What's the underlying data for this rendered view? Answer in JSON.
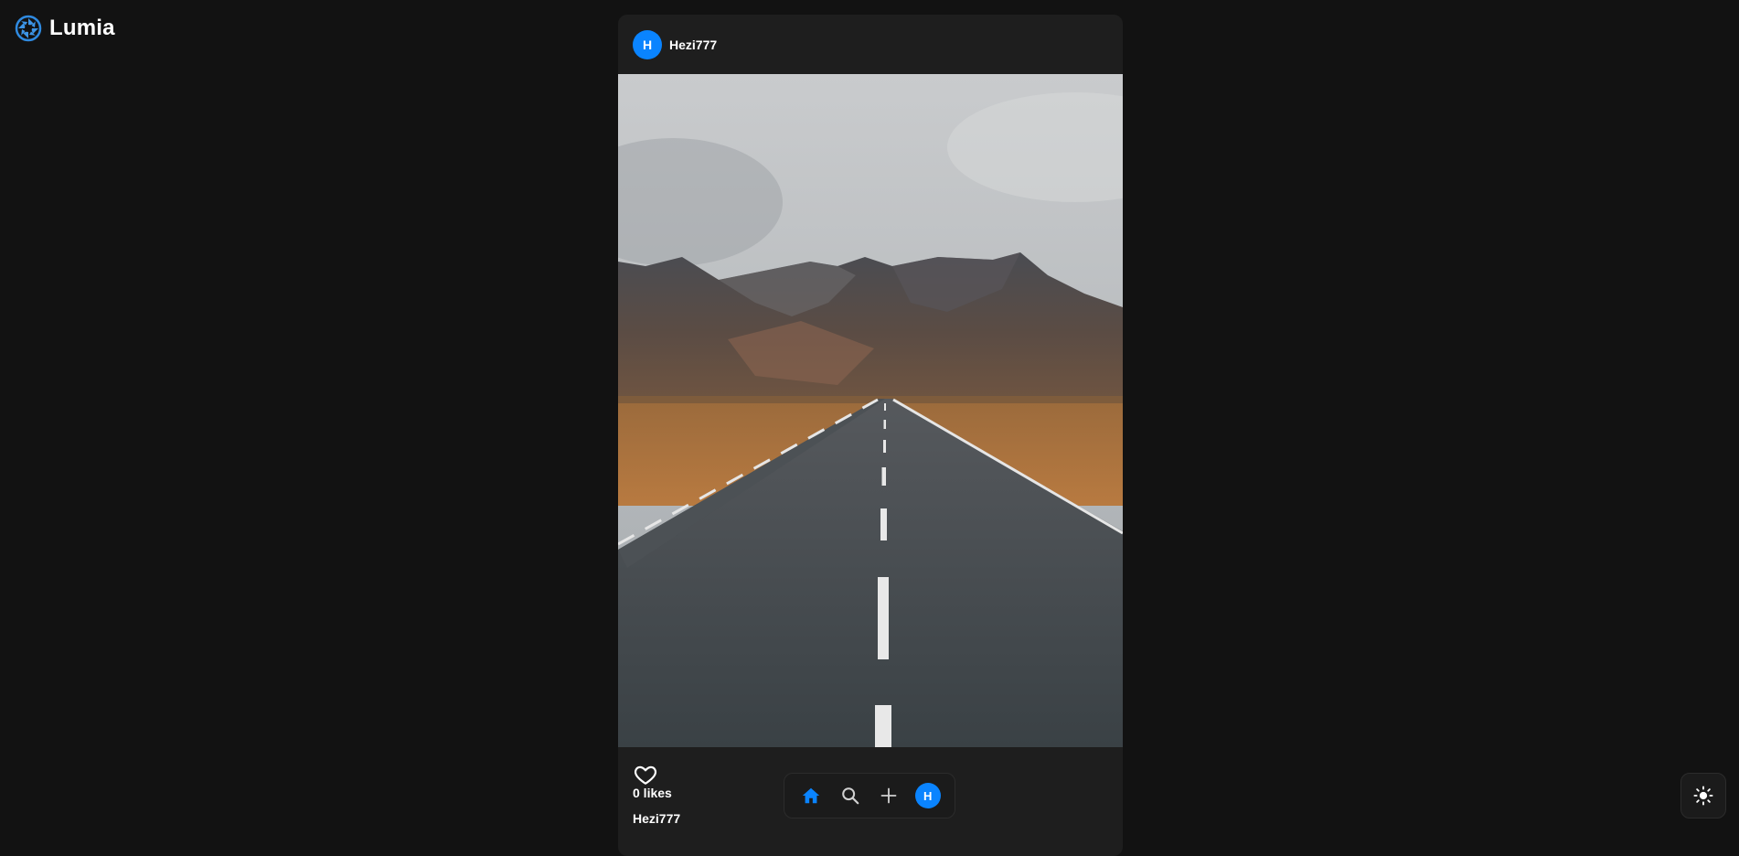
{
  "app": {
    "name": "Lumia",
    "logo_icon": "aperture-icon",
    "accent_color": "#0a84ff"
  },
  "post": {
    "author": {
      "username": "Hezi777",
      "avatar_initial": "H"
    },
    "image_subject": "mountain-road-photo",
    "likes_text": "0 likes",
    "caption_username": "Hezi777"
  },
  "nav": {
    "items": [
      {
        "name": "home",
        "icon": "home-icon",
        "active": true
      },
      {
        "name": "search",
        "icon": "search-icon",
        "active": false
      },
      {
        "name": "create",
        "icon": "plus-icon",
        "active": false
      },
      {
        "name": "profile",
        "icon": "avatar",
        "initial": "H",
        "active": false
      }
    ]
  },
  "theme_toggle": {
    "icon": "sun-icon"
  }
}
